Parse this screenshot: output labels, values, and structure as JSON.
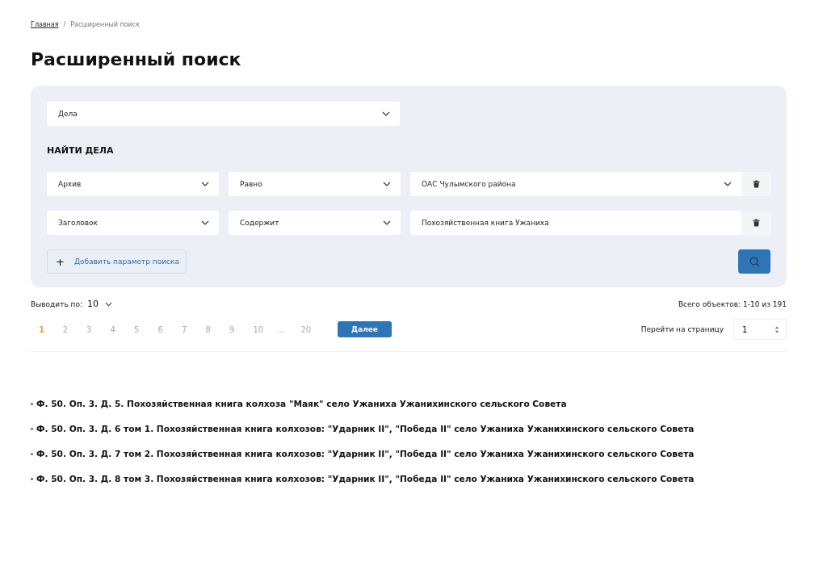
{
  "breadcrumb": [
    {
      "label": "Главная",
      "link": true
    },
    {
      "label": "Расширенный поиск",
      "link": false
    }
  ],
  "breadcrumb_separator": "/",
  "title": "Расширенный поиск",
  "search": {
    "entity_select": "Дела",
    "section_title": "НАЙТИ ДЕЛА",
    "criteria": [
      {
        "field": "Архив",
        "operator": "Равно",
        "value": "ОАС Чулымского района",
        "kind": "select"
      },
      {
        "field": "Заголовок",
        "operator": "Содержит",
        "value": "Похозяйственная книга Ужаниха",
        "kind": "text"
      }
    ],
    "add_button": {
      "icon": "+",
      "label": "Добавить параметр поиска"
    }
  },
  "page_size": {
    "label": "Выводить по:",
    "value": "10"
  },
  "total": "Всего объектов: 1-10 из 191",
  "pagination": [
    {
      "label": "1",
      "selected": true
    },
    {
      "label": "2",
      "selected": false
    },
    {
      "label": "3",
      "selected": false
    },
    {
      "label": "4",
      "selected": false
    },
    {
      "label": "5",
      "selected": false
    },
    {
      "label": "6",
      "selected": false
    },
    {
      "label": "7",
      "selected": false
    },
    {
      "label": "8",
      "selected": false
    },
    {
      "label": "9",
      "selected": false
    },
    {
      "label": "10",
      "selected": false
    },
    {
      "label": "…",
      "selected": false
    },
    {
      "label": "20",
      "selected": false
    }
  ],
  "next_button": "Далее",
  "goto": {
    "label": "Перейти на страницу",
    "value": "1"
  },
  "results": [
    "Ф. 50. Оп. 3. Д. 5. Похозяйственная книга колхоза \"Маяк\" село Ужаниха Ужанихинского сельского Совета",
    "Ф. 50. Оп. 3. Д. 6 том 1. Похозяйственная книга колхозов: \"Ударник II\", \"Победа II\" село Ужаниха Ужанихинского сельского Совета",
    "Ф. 50. Оп. 3. Д. 7 том 2. Похозяйственная книга колхозов: \"Ударник II\", \"Победа II\" село Ужаниха Ужанихинского сельского Совета",
    "Ф. 50. Оп. 3. Д. 8 том 3. Похозяйственная книга колхозов: \"Ударник II\", \"Победа II\" село Ужаниха Ужанихинского сельского Совета"
  ]
}
